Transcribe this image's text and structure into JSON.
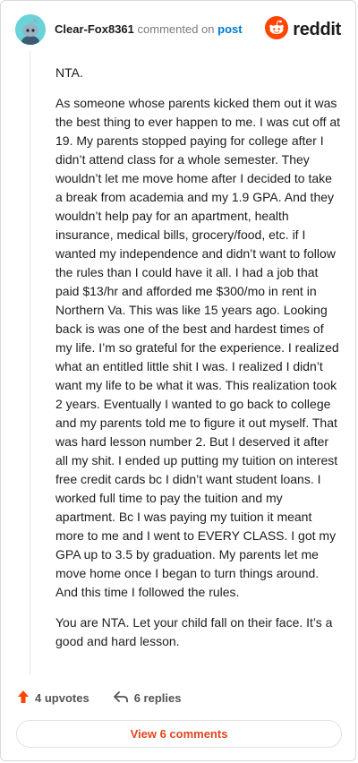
{
  "header": {
    "username": "Clear-Fox8361",
    "commented_on": "commented on",
    "post_link": "post",
    "brand": "reddit",
    "avatar_icon": "snoo-avatar-icon",
    "brand_icon": "reddit-logo-icon",
    "colors": {
      "avatar_bg": "#69d3d8",
      "link": "#0079d3",
      "brand": "#ff4500"
    }
  },
  "comment": {
    "paragraphs": [
      "NTA.",
      "As someone whose parents kicked them out it was the best thing to ever happen to me. I was cut off at 19. My parents stopped paying for college after I didn’t attend class for a whole semester. They wouldn’t let me move home after I decided to take a break from academia and my 1.9 GPA. And they wouldn’t help pay for an apartment, health insurance, medical bills, grocery/food, etc. if I wanted my independence and didn’t want to follow the rules than I could have it all. I had a job that paid $13/hr and afforded me $300/mo in rent in Northern Va. This was like 15 years ago. Looking back is was one of the best and hardest times of my life. I’m so grateful for the experience. I realized what an entitled little shit I was. I realized I didn’t want my life to be what it was. This realization took 2 years. Eventually I wanted to go back to college and my parents told me to figure it out myself. That was hard lesson number 2. But I deserved it after all my shit. I ended up putting my tuition on interest free credit cards bc I didn’t want student loans. I worked full time to pay the tuition and my apartment. Bc I was paying my tuition it meant more to me and I went to EVERY CLASS. I got my GPA up to 3.5 by graduation. My parents let me move home once I began to turn things around. And this time I followed the rules.",
      "You are NTA. Let your child fall on their face. It’s a good and hard lesson."
    ]
  },
  "actions": {
    "upvotes": "4 upvotes",
    "replies": "6 replies",
    "upvote_icon": "upvote-arrow-icon",
    "reply_icon": "reply-arrow-icon",
    "upvote_color": "#ff4500"
  },
  "footer": {
    "view_comments": "View 6 comments",
    "button_color": "#e0461e"
  }
}
